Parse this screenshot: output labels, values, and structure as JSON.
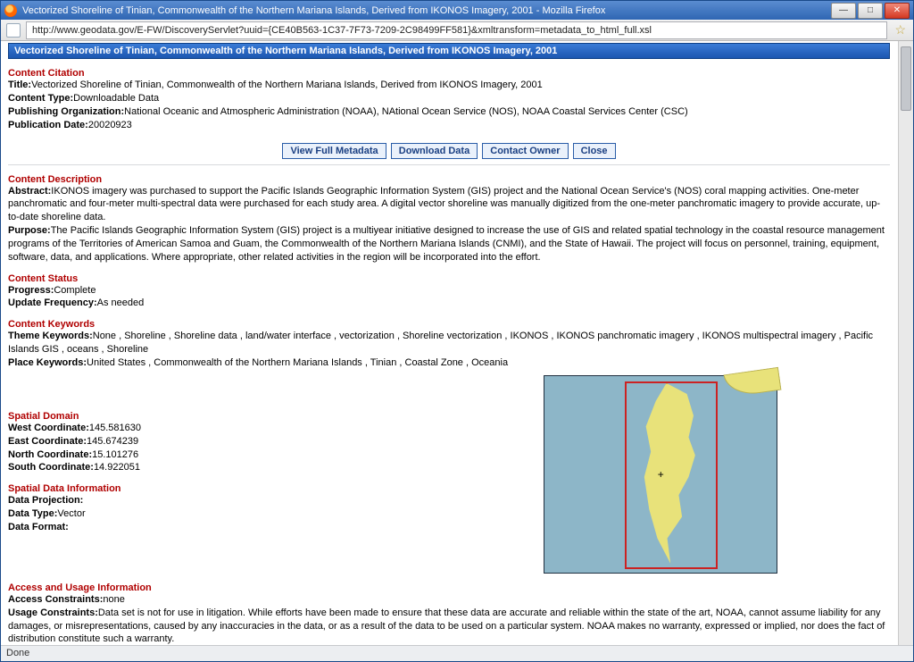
{
  "window": {
    "title": "Vectorized Shoreline of Tinian, Commonwealth of the Northern Mariana Islands, Derived from IKONOS Imagery, 2001 - Mozilla Firefox",
    "url": "http://www.geodata.gov/E-FW/DiscoveryServlet?uuid={CE40B563-1C37-7F73-7209-2C98499FF581}&xmltransform=metadata_to_html_full.xsl",
    "status": "Done"
  },
  "banner": "Vectorized Shoreline of Tinian, Commonwealth of the Northern Mariana Islands, Derived from IKONOS Imagery, 2001",
  "citation": {
    "heading": "Content Citation",
    "title_label": "Title:",
    "title": "Vectorized Shoreline of Tinian, Commonwealth of the Northern Mariana Islands, Derived from IKONOS Imagery, 2001",
    "type_label": "Content Type:",
    "type": "Downloadable Data",
    "org_label": "Publishing Organization:",
    "org": "National Oceanic and Atmospheric Administration (NOAA), NAtional Ocean Service (NOS), NOAA Coastal Services Center (CSC)",
    "date_label": "Publication Date:",
    "date": "20020923"
  },
  "buttons": {
    "view_full": "View Full Metadata",
    "download": "Download Data",
    "contact": "Contact Owner",
    "close": "Close"
  },
  "description": {
    "heading": "Content Description",
    "abstract_label": "Abstract:",
    "abstract": "IKONOS imagery was purchased to support the Pacific Islands Geographic Information System (GIS) project and the National Ocean Service's (NOS) coral mapping activities. One-meter panchromatic and four-meter multi-spectral data were purchased for each study area. A digital vector shoreline was manually digitized from the one-meter panchromatic imagery to provide accurate, up-to-date shoreline data.",
    "purpose_label": "Purpose:",
    "purpose": "The Pacific Islands Geographic Information System (GIS) project is a multiyear initiative designed to increase the use of GIS and related spatial technology in the coastal resource management programs of the Territories of American Samoa and Guam, the Commonwealth of the Northern Mariana Islands (CNMI), and the State of Hawaii. The project will focus on personnel, training, equipment, software, data, and applications. Where appropriate, other related activities in the region will be incorporated into the effort."
  },
  "status_section": {
    "heading": "Content Status",
    "progress_label": "Progress:",
    "progress": "Complete",
    "update_label": "Update Frequency:",
    "update": "As needed"
  },
  "keywords": {
    "heading": "Content Keywords",
    "theme_label": "Theme Keywords:",
    "theme": "None , Shoreline , Shoreline data , land/water interface , vectorization , Shoreline vectorization , IKONOS , IKONOS panchromatic imagery , IKONOS multispectral imagery , Pacific Islands GIS , oceans , Shoreline",
    "place_label": "Place Keywords:",
    "place": "United States , Commonwealth of the Northern Mariana Islands , Tinian , Coastal Zone , Oceania"
  },
  "spatial_domain": {
    "heading": "Spatial Domain",
    "west_label": "West Coordinate:",
    "west": "145.581630",
    "east_label": "East Coordinate:",
    "east": "145.674239",
    "north_label": "North Coordinate:",
    "north": "15.101276",
    "south_label": "South Coordinate:",
    "south": "14.922051"
  },
  "spatial_data": {
    "heading": "Spatial Data Information",
    "proj_label": "Data Projection:",
    "proj": "",
    "type_label": "Data Type:",
    "type": "Vector",
    "format_label": "Data Format:",
    "format": ""
  },
  "access": {
    "heading": "Access and Usage Information",
    "access_label": "Access Constraints:",
    "access": "none",
    "usage_label": "Usage Constraints:",
    "usage": "Data set is not for use in litigation. While efforts have been made to ensure that these data are accurate and reliable within the state of the art, NOAA, cannot assume liability for any damages, or misrepresentations, caused by any inaccuracies in the data, or as a result of the data to be used on a particular system. NOAA makes no warranty, expressed or implied, nor does the fact of distribution constitute such a warranty."
  }
}
